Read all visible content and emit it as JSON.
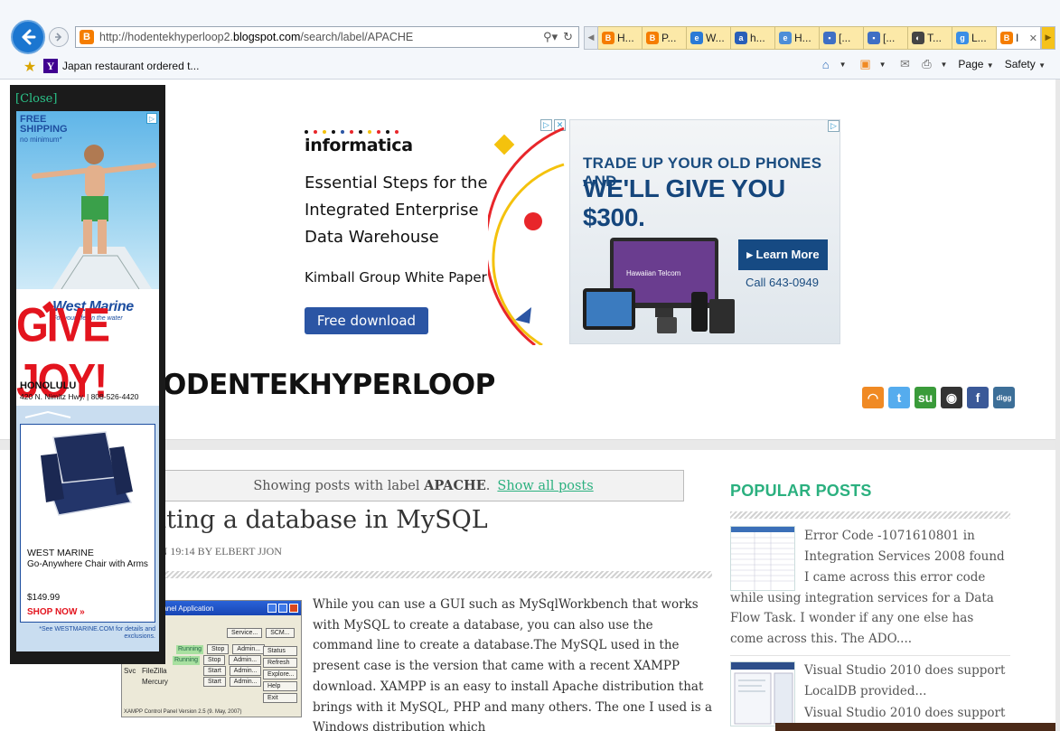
{
  "browser": {
    "address_url_prefix": "http://hodentekhyperloop2.",
    "address_url_domain": "blogspot.com",
    "address_url_path": "/search/label/APACHE",
    "address_favicon": "B",
    "tabs": [
      {
        "label": "H...",
        "icon": "blogger-icon",
        "icon_text": "B",
        "color": "#f57d00"
      },
      {
        "label": "P...",
        "icon": "blogger-icon",
        "icon_text": "B",
        "color": "#f57d00"
      },
      {
        "label": "W...",
        "icon": "ie-icon",
        "icon_text": "e",
        "color": "#2a7ad6"
      },
      {
        "label": "h...",
        "icon": "ask-icon",
        "icon_text": "a",
        "color": "#2a5fb8"
      },
      {
        "label": "H...",
        "icon": "ie-icon",
        "icon_text": "e",
        "color": "#4d8ed8"
      },
      {
        "label": "[...",
        "icon": "msdn-icon",
        "icon_text": "▪",
        "color": "#3f6fc4"
      },
      {
        "label": "[...",
        "icon": "msdn-icon",
        "icon_text": "▪",
        "color": "#3f6fc4"
      },
      {
        "label": "T...",
        "icon": "avatar-icon",
        "icon_text": "◐",
        "color": "#444444"
      },
      {
        "label": "L...",
        "icon": "google-icon",
        "icon_text": "g",
        "color": "#3a8ee6"
      },
      {
        "label": "I",
        "icon": "blogger-icon",
        "icon_text": "B",
        "color": "#f57d00",
        "active": true,
        "close": "✕"
      }
    ],
    "favorites_link": "Japan restaurant ordered t...",
    "favorites_link_icon": "Y",
    "cmd_page": "Page",
    "cmd_safety": "Safety"
  },
  "float_ad": {
    "close": "[Close]",
    "free_shipping": "FREE SHIPPING",
    "no_minimum": "no minimum*",
    "brand": "West Marine",
    "tagline": "For your life on the water",
    "headline": "GIVE JOY!",
    "city": "HONOLULU",
    "address": "420 N. Nimitz Hwy. | 808-526-4420",
    "product_brand": "WEST MARINE",
    "product_name": "Go-Anywhere Chair with Arms",
    "price": "$149.99",
    "cta": "SHOP NOW »",
    "footer": "*See WESTMARINE.COM for details and exclusions."
  },
  "ad_informatica": {
    "logo": "informatica",
    "headline": "Essential Steps for the Integrated Enterprise Data Warehouse",
    "sub": "Kimball Group White Paper",
    "button": "Free download"
  },
  "ad_hawaiian": {
    "line1": "TRADE UP YOUR OLD PHONES AND",
    "line2": "WE'LL GIVE YOU $300.",
    "button": "▸ Learn More",
    "call": "Call 643-0949",
    "device_brand": "Hawaiian Telcom"
  },
  "blog": {
    "title": "ODENTEKHYPERLOOP",
    "social": [
      {
        "name": "rss-icon",
        "glyph": "◠",
        "color": "#f08a24"
      },
      {
        "name": "twitter-icon",
        "glyph": "t",
        "color": "#55acee"
      },
      {
        "name": "stumbleupon-icon",
        "glyph": "su",
        "color": "#3a9b3a"
      },
      {
        "name": "reddit-icon",
        "glyph": "◉",
        "color": "#333333"
      },
      {
        "name": "facebook-icon",
        "glyph": "f",
        "color": "#3b5998"
      },
      {
        "name": "digg-icon",
        "glyph": "digg",
        "color": "#3d6f98"
      }
    ]
  },
  "label_bar": {
    "showing": "Showing posts with label",
    "label": "APACHE",
    "show_all": "Show all posts"
  },
  "post": {
    "title": "ating a database in MySQL",
    "meta": "ON 19:14 BY ELBERT JJON",
    "text": "While you can use a GUI such as MySqlWorkbench that works with MySQL to create a database, you can also use the command line to create a database.The MySQL used in the present case is the version that came with a recent XAMPP download. XAMPP is an easy to install Apache distribution that brings with it MySQL, PHP and many others. The one I used is a Windows distribution which",
    "screenshot": {
      "title": "Panel Application",
      "subtitle": "PP Control Panel",
      "service_btn": "Service...",
      "scm_btn": "SCM...",
      "rows": [
        {
          "check": "Svc",
          "module": "MySql",
          "status": "Running",
          "btn1": "Stop",
          "btn2": "Admin..."
        },
        {
          "check": "Svc",
          "module": "FileZilla",
          "status": "",
          "btn1": "Start",
          "btn2": "Admin..."
        },
        {
          "check": "",
          "module": "Mercury",
          "status": "",
          "btn1": "Start",
          "btn2": "Admin..."
        }
      ],
      "row0": {
        "status": "Running",
        "btn1": "Stop",
        "btn2": "Admin..."
      },
      "side_buttons": [
        "Status",
        "Refresh",
        "Explore...",
        "Help",
        "Exit"
      ],
      "footer": "XAMPP Control Panel Version 2.5 (9. May, 2007)"
    }
  },
  "popular": {
    "heading": "POPULAR POSTS",
    "item1_title": "Error Code -1071610801 in Integration Services 2008 found",
    "item1_snippet": "I came across this error code while using integration services for a Data Flow Task. I wonder if any one else has come across this. The ADO....",
    "item2_title": "Visual Studio 2010 does support LocalDB provided...",
    "item3_title": "Visual Studio 2010 does support"
  }
}
